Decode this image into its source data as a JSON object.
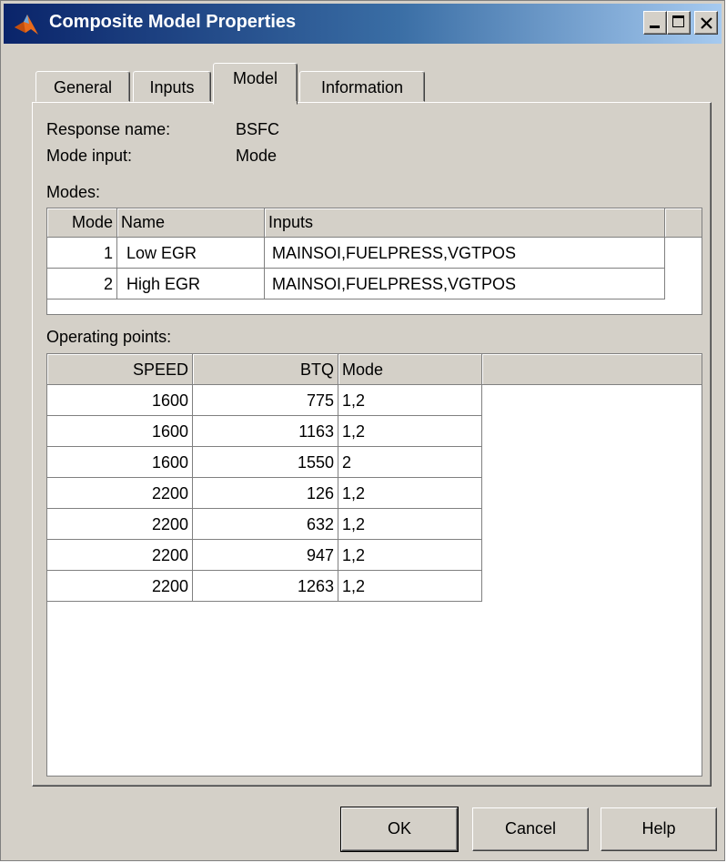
{
  "window": {
    "title": "Composite Model Properties",
    "minimize_label": "",
    "maximize_label": "",
    "close_label": ""
  },
  "tabs": [
    {
      "label": "General"
    },
    {
      "label": "Inputs"
    },
    {
      "label": "Model",
      "selected": true
    },
    {
      "label": "Information"
    }
  ],
  "model": {
    "response_name_label": "Response name:",
    "response_name_value": "BSFC",
    "mode_input_label": "Mode input:",
    "mode_input_value": "Mode",
    "modes_label": "Modes:",
    "modes_table": {
      "columns": [
        "Mode",
        "Name",
        "Inputs"
      ],
      "rows": [
        {
          "mode": "1",
          "name": "Low EGR",
          "inputs": "MAINSOI,FUELPRESS,VGTPOS"
        },
        {
          "mode": "2",
          "name": "High EGR",
          "inputs": "MAINSOI,FUELPRESS,VGTPOS"
        }
      ]
    },
    "operating_points_label": "Operating points:",
    "operating_points_table": {
      "columns": [
        "SPEED",
        "BTQ",
        "Mode"
      ],
      "rows": [
        {
          "speed": "1600",
          "btq": "775",
          "mode": "1,2"
        },
        {
          "speed": "1600",
          "btq": "1163",
          "mode": "1,2"
        },
        {
          "speed": "1600",
          "btq": "1550",
          "mode": "2"
        },
        {
          "speed": "2200",
          "btq": "126",
          "mode": "1,2"
        },
        {
          "speed": "2200",
          "btq": "632",
          "mode": "1,2"
        },
        {
          "speed": "2200",
          "btq": "947",
          "mode": "1,2"
        },
        {
          "speed": "2200",
          "btq": "1263",
          "mode": "1,2"
        }
      ]
    }
  },
  "buttons": {
    "ok": "OK",
    "cancel": "Cancel",
    "help": "Help"
  },
  "colors": {
    "title_bar_start": "#0a246a",
    "title_bar_end": "#a6caf0",
    "dialog_face": "#d4d0c8"
  },
  "icons": {
    "app": "matlab-logo-icon",
    "close": "close-icon"
  }
}
